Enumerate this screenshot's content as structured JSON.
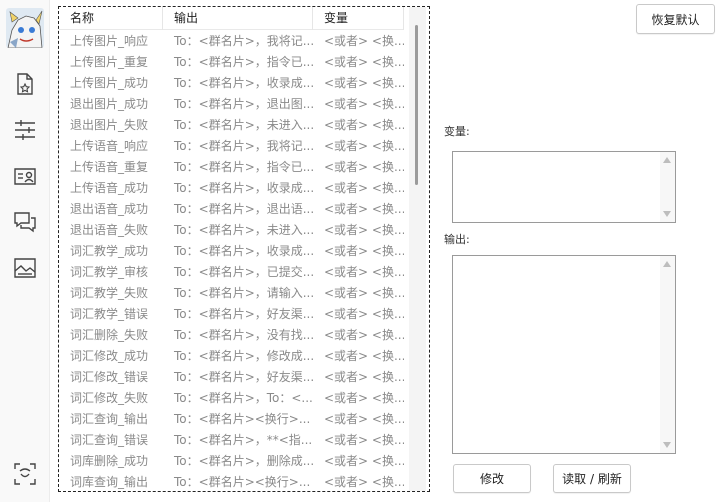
{
  "header": {
    "col_name": "名称",
    "col_output": "输出",
    "col_var": "变量"
  },
  "rows": [
    {
      "name": "上传图片_响应",
      "output": "To：<群名片>，我将记...",
      "var": "<或者> <换..."
    },
    {
      "name": "上传图片_重复",
      "output": "To：<群名片>，指令已...",
      "var": "<或者> <换..."
    },
    {
      "name": "上传图片_成功",
      "output": "To：<群名片>，收录成...",
      "var": "<或者> <换..."
    },
    {
      "name": "退出图片_成功",
      "output": "To：<群名片>，退出图...",
      "var": "<或者> <换..."
    },
    {
      "name": "退出图片_失败",
      "output": "To：<群名片>，未进入...",
      "var": "<或者> <换..."
    },
    {
      "name": "上传语音_响应",
      "output": "To：<群名片>，我将记...",
      "var": "<或者> <换..."
    },
    {
      "name": "上传语音_重复",
      "output": "To：<群名片>，指令已...",
      "var": "<或者> <换..."
    },
    {
      "name": "上传语音_成功",
      "output": "To：<群名片>，收录成...",
      "var": "<或者> <换..."
    },
    {
      "name": "退出语音_成功",
      "output": "To：<群名片>，退出语...",
      "var": "<或者> <换..."
    },
    {
      "name": "退出语音_失败",
      "output": "To：<群名片>，未进入...",
      "var": "<或者> <换..."
    },
    {
      "name": "词汇教学_成功",
      "output": "To：<群名片>，收录成...",
      "var": "<或者> <换..."
    },
    {
      "name": "词汇教学_审核",
      "output": "To：<群名片>，已提交...",
      "var": "<或者> <换..."
    },
    {
      "name": "词汇教学_失败",
      "output": "To：<群名片>，请输入...",
      "var": "<或者> <换..."
    },
    {
      "name": "词汇教学_错误",
      "output": "To：<群名片>，好友渠...",
      "var": "<或者> <换..."
    },
    {
      "name": "词汇删除_失败",
      "output": "To：<群名片>，没有找...",
      "var": "<或者> <换..."
    },
    {
      "name": "词汇修改_成功",
      "output": "To：<群名片>，修改成...",
      "var": "<或者> <换..."
    },
    {
      "name": "词汇修改_错误",
      "output": "To：<群名片>，好友渠...",
      "var": "<或者> <换..."
    },
    {
      "name": "词汇修改_失败",
      "output": "To：<群名片>，To：<...",
      "var": "<或者> <换..."
    },
    {
      "name": "词汇查询_输出",
      "output": "To：<群名片><换行>...",
      "var": "<或者> <换..."
    },
    {
      "name": "词汇查询_错误",
      "output": "To：<群名片>，**<指...",
      "var": "<或者> <换..."
    },
    {
      "name": "词库删除_成功",
      "output": "To：<群名片>，删除成...",
      "var": "<或者> <换..."
    },
    {
      "name": "词库查询_输出",
      "output": "To：<群名片><换行>...",
      "var": "<或者> <换..."
    }
  ],
  "right": {
    "restore_label": "恢复默认",
    "var_label": "变量:",
    "output_label": "输出:",
    "modify_label": "修改",
    "refresh_label": "读取 / 刷新",
    "var_value": "",
    "output_value": ""
  },
  "sidebar": {
    "items": [
      "file-star-icon",
      "sliders-icon",
      "contact-card-icon",
      "chat-bubbles-icon",
      "image-icon",
      "face-scan-icon"
    ]
  }
}
